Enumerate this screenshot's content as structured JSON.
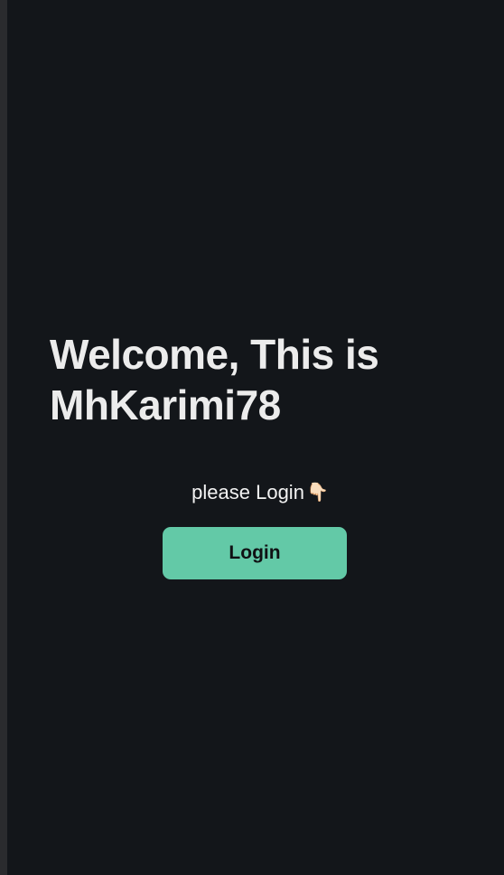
{
  "welcome": {
    "line1": "Welcome, This is",
    "line2": "MhKarimi78"
  },
  "prompt": {
    "text": "please Login",
    "icon": "👇🏻"
  },
  "login_button": {
    "label": "Login"
  },
  "colors": {
    "background": "#13161a",
    "accent": "#63c9a7",
    "text": "#ececec"
  }
}
